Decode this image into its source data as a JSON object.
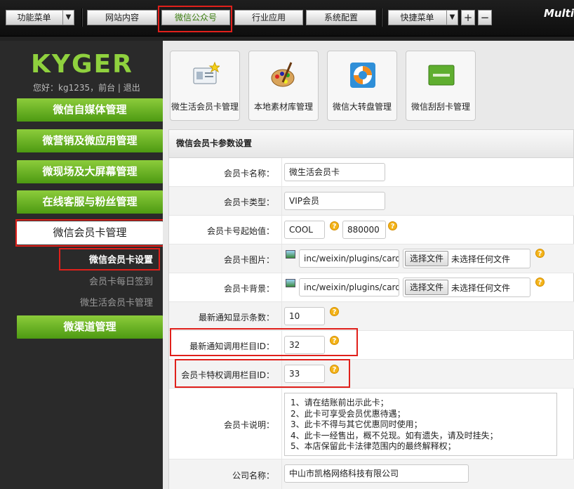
{
  "topbar": {
    "menu_label": "功能菜单",
    "tabs": [
      "网站内容",
      "微信公众号",
      "行业应用",
      "系统配置"
    ],
    "quick_menu_label": "快捷菜单",
    "add_label": "+",
    "remove_label": "−",
    "brand": "Multi"
  },
  "sidebar": {
    "logo_text": "KYGER",
    "greeting": "您好：kg1235，前台 | 退出",
    "groups": [
      "微信自媒体管理",
      "微营销及微应用管理",
      "微现场及大屏幕管理",
      "在线客服与粉丝管理",
      "微信会员卡管理",
      "微渠道管理"
    ],
    "subitems": [
      "微信会员卡设置",
      "会员卡每日签到",
      "微生活会员卡管理"
    ]
  },
  "quick_links": [
    {
      "label": "微生活会员卡管理",
      "icon": "member-card-icon"
    },
    {
      "label": "本地素材库管理",
      "icon": "palette-icon"
    },
    {
      "label": "微信大转盘管理",
      "icon": "lifebuoy-icon"
    },
    {
      "label": "微信刮刮卡管理",
      "icon": "scratch-card-icon"
    }
  ],
  "form": {
    "title": "微信会员卡参数设置",
    "card_name": {
      "label": "会员卡名称：",
      "value": "微生活会员卡"
    },
    "card_type": {
      "label": "会员卡类型：",
      "value": "VIP会员"
    },
    "card_no": {
      "label": "会员卡号起始值：",
      "prefix": "COOL",
      "start": "880000"
    },
    "card_image": {
      "label": "会员卡图片：",
      "path": "inc/weixin/plugins/card",
      "button": "选择文件",
      "status": "未选择任何文件"
    },
    "card_bg": {
      "label": "会员卡背景：",
      "path": "inc/weixin/plugins/card",
      "button": "选择文件",
      "status": "未选择任何文件"
    },
    "notice_count": {
      "label": "最新通知显示条数：",
      "value": "10"
    },
    "notice_column": {
      "label": "最新通知调用栏目ID：",
      "value": "32"
    },
    "privilege_column": {
      "label": "会员卡特权调用栏目ID：",
      "value": "33"
    },
    "description": {
      "label": "会员卡说明：",
      "value": "1、请在结账前出示此卡；\n2、此卡可享受会员优惠待遇；\n3、此卡不得与其它优惠同时使用；\n4、此卡一经售出，概不兑现。如有遗失，请及时挂失；\n5、本店保留此卡法律范围内的最终解释权；"
    },
    "company": {
      "label": "公司名称：",
      "value": "中山市凯格网络科技有限公司"
    },
    "help_glyph": "?"
  },
  "colors": {
    "highlight": "#e0201b",
    "nav_green": "#5ea51d",
    "help_orange": "#f4b419"
  }
}
